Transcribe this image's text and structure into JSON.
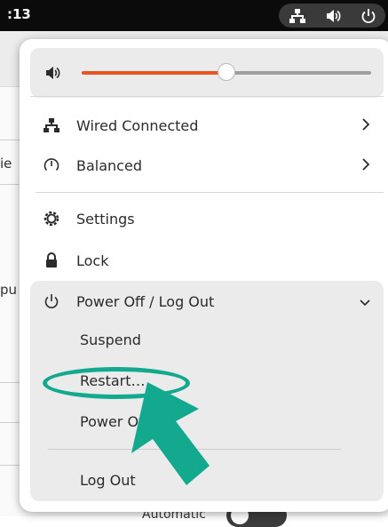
{
  "topbar": {
    "clock": ":13",
    "icons": [
      "wired-network-icon",
      "volume-icon",
      "power-icon"
    ]
  },
  "background_window": {
    "fragments": [
      "ie",
      "pu"
    ],
    "bottom_text": "Automatic"
  },
  "quick_settings": {
    "volume": {
      "icon": "volume-icon",
      "level_percent": 50,
      "accent": "#e95420"
    },
    "items": [
      {
        "label": "Wired Connected",
        "icon": "wired-network-icon",
        "has_submenu": true
      },
      {
        "label": "Balanced",
        "icon": "power-profile-icon",
        "has_submenu": true
      },
      {
        "label": "Settings",
        "icon": "gear-icon",
        "has_submenu": false
      },
      {
        "label": "Lock",
        "icon": "lock-icon",
        "has_submenu": false
      }
    ],
    "power_submenu": {
      "label": "Power Off / Log Out",
      "icon": "power-icon",
      "expanded": true,
      "items": [
        "Suspend",
        "Restart…",
        "Power Off…",
        "Log Out"
      ]
    }
  },
  "annotation": {
    "color": "#12a98f",
    "target": "Restart…"
  }
}
